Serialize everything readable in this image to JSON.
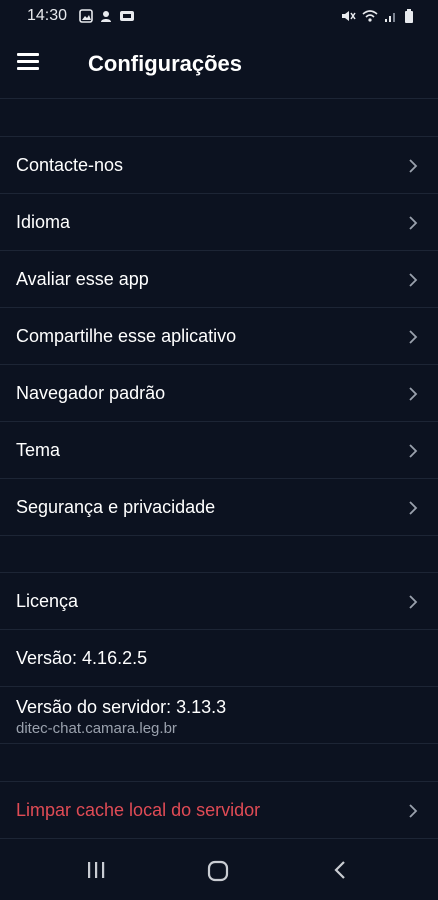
{
  "status_bar": {
    "time": "14:30",
    "left_icons": [
      "image-icon",
      "notification-icon",
      "badge-icon"
    ],
    "right_icons": [
      "mute-icon",
      "wifi-icon",
      "signal-icon",
      "battery-icon"
    ]
  },
  "app_bar": {
    "title": "Configurações"
  },
  "section1": [
    {
      "label": "Contacte-nos"
    },
    {
      "label": "Idioma"
    },
    {
      "label": "Avaliar esse app"
    },
    {
      "label": "Compartilhe esse aplicativo"
    },
    {
      "label": "Navegador padrão"
    },
    {
      "label": "Tema"
    },
    {
      "label": "Segurança e privacidade"
    }
  ],
  "section2": {
    "license": "Licença",
    "version": "Versão: 4.16.2.5",
    "server_version": "Versão do servidor: 3.13.3",
    "server_host": "ditec-chat.camara.leg.br"
  },
  "section3": {
    "clear_cache": "Limpar cache local do servidor"
  },
  "colors": {
    "background": "#0c1220",
    "divider": "#1d2535",
    "danger": "#e04b55"
  }
}
